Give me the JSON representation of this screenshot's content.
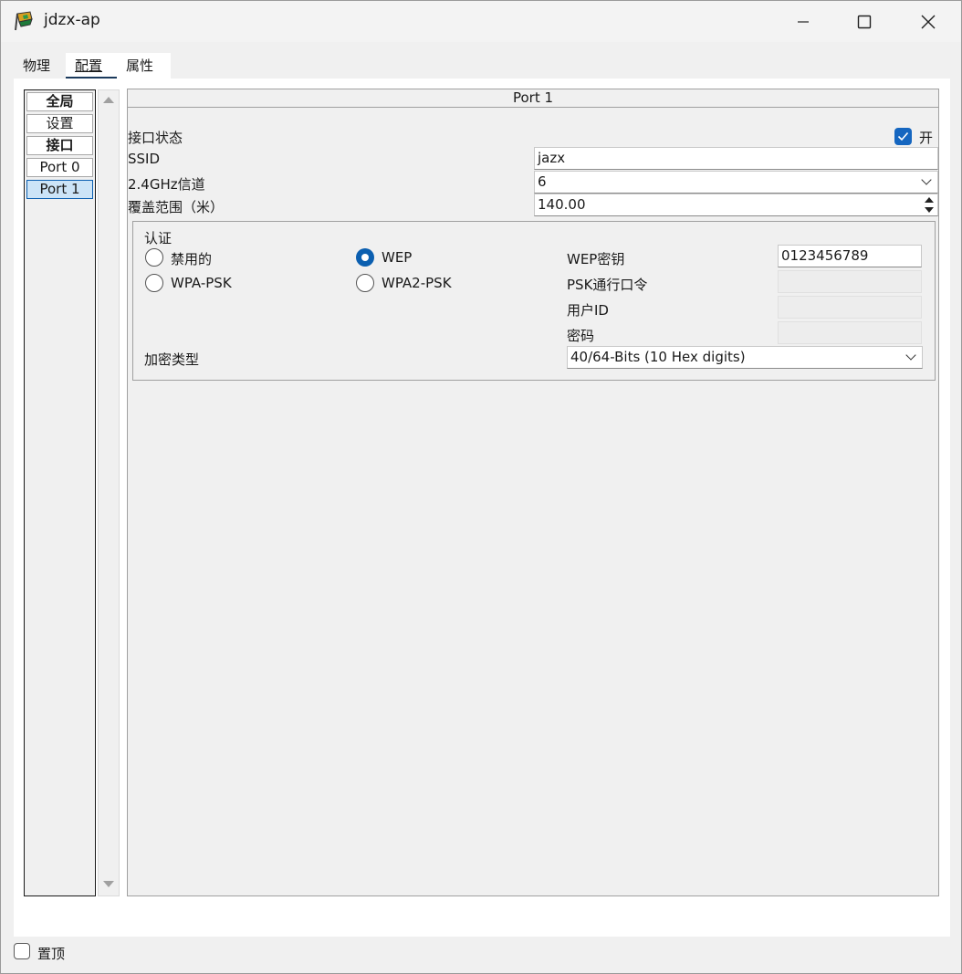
{
  "window": {
    "title": "jdzx-ap",
    "icon": "router-ap-icon"
  },
  "tabs": [
    {
      "label": "物理",
      "active": false
    },
    {
      "label": "配置",
      "active": true
    },
    {
      "label": "属性",
      "active": false
    }
  ],
  "nav": {
    "items": [
      {
        "label": "全局",
        "bold": true
      },
      {
        "label": "设置",
        "bold": false
      },
      {
        "label": "接口",
        "bold": true
      },
      {
        "label": "Port 0",
        "bold": false
      },
      {
        "label": "Port 1",
        "bold": false,
        "selected": true
      }
    ]
  },
  "panel": {
    "header": "Port 1",
    "port_status": {
      "label": "接口状态",
      "checkbox_label": "开",
      "checked": true
    },
    "ssid": {
      "label": "SSID",
      "value": "jazx"
    },
    "channel": {
      "label": "2.4GHz信道",
      "value": "6"
    },
    "coverage": {
      "label": "覆盖范围（米）",
      "value": "140.00"
    },
    "auth": {
      "title": "认证",
      "options": [
        {
          "label": "禁用的",
          "selected": false
        },
        {
          "label": "WEP",
          "selected": true
        },
        {
          "label": "WPA-PSK",
          "selected": false
        },
        {
          "label": "WPA2-PSK",
          "selected": false
        }
      ],
      "wep_key": {
        "label": "WEP密钥",
        "value": "0123456789"
      },
      "psk_passphrase": {
        "label": "PSK通行口令",
        "value": ""
      },
      "user_id": {
        "label": "用户ID",
        "value": ""
      },
      "password": {
        "label": "密码",
        "value": ""
      },
      "encryption": {
        "label": "加密类型",
        "value": "40/64-Bits (10 Hex digits)"
      }
    }
  },
  "footer": {
    "always_on_top": {
      "label": "置顶",
      "checked": false
    }
  },
  "colors": {
    "accent": "#0b5fb0",
    "checkbox": "#1566c0",
    "selected_nav": "#cce4f7"
  }
}
